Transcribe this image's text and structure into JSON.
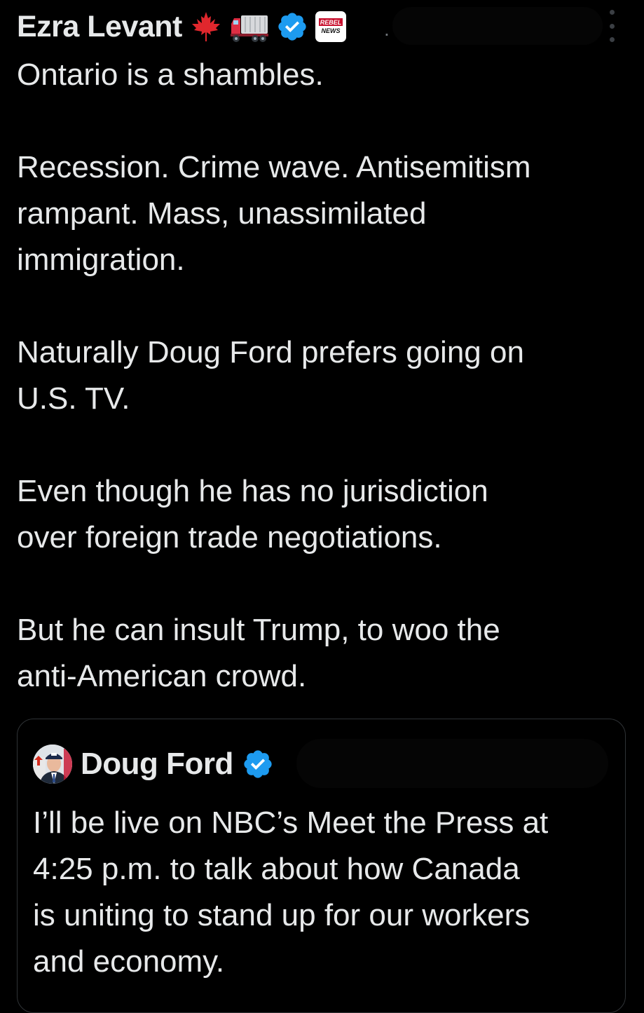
{
  "post": {
    "author": {
      "name": "Ezra Levant",
      "badges": [
        "maple-leaf-emoji",
        "truck-emoji",
        "verified-badge-icon",
        "rebel-news-affiliate-badge"
      ],
      "affiliate_badge_text": "REBEL NEWS"
    },
    "separator": ".",
    "text": "Ontario is a shambles.\n\nRecession. Crime wave. Antisemitism\nrampant. Mass, unassimilated\nimmigration.\n\nNaturally Doug Ford prefers going on\nU.S. TV.\n\nEven though he has no jurisdiction\nover foreign trade negotiations.\n\nBut he can insult Trump, to woo the\nanti-American crowd."
  },
  "quoted_post": {
    "author": {
      "name": "Doug Ford",
      "badges": [
        "verified-badge-icon"
      ]
    },
    "text": "I’ll be live on NBC’s Meet the Press at\n4:25 p.m. to talk about how Canada\nis uniting to stand up for our workers\nand economy."
  },
  "colors": {
    "background": "#000000",
    "text": "#e7e9ea",
    "verified": "#1d9bf0",
    "card_border": "#2f3336",
    "maple_leaf": "#e0272d",
    "truck_cab": "#dd2e44"
  }
}
